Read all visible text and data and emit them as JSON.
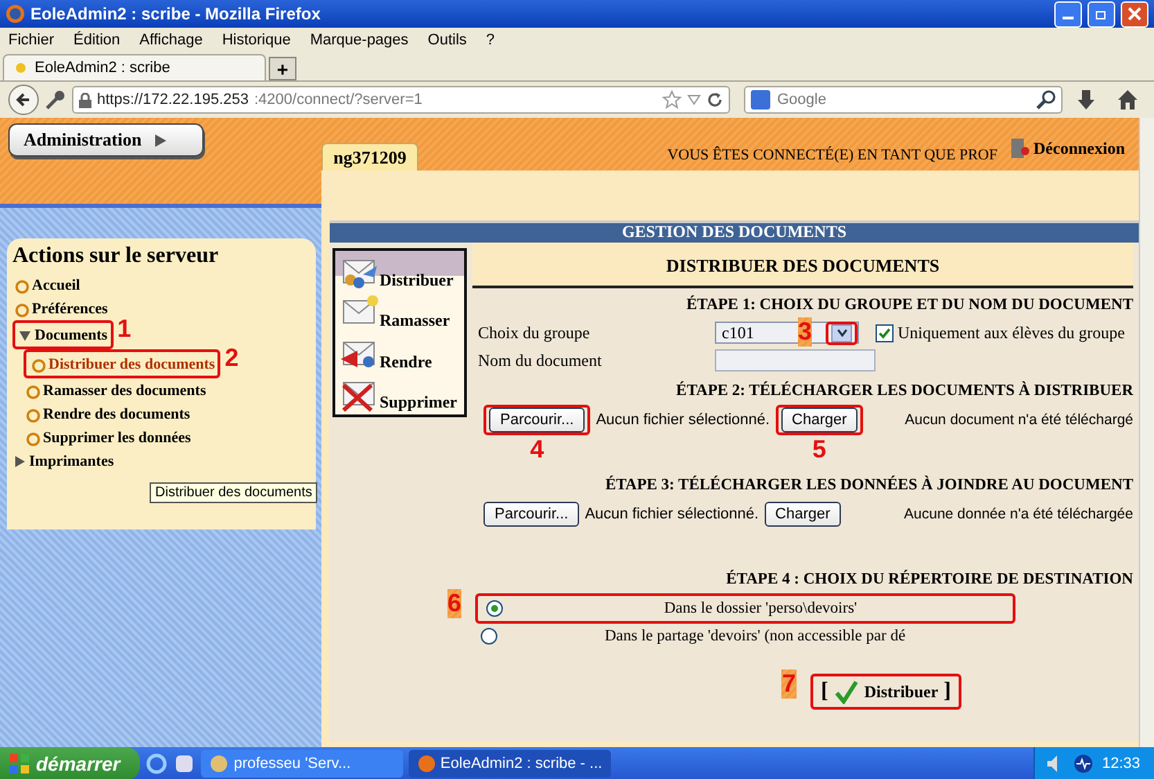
{
  "window": {
    "title": "EoleAdmin2 : scribe - Mozilla Firefox"
  },
  "menu": [
    "Fichier",
    "Édition",
    "Affichage",
    "Historique",
    "Marque-pages",
    "Outils",
    "?"
  ],
  "tabs": [
    {
      "label": "EoleAdmin2 : scribe",
      "selected": true
    }
  ],
  "new_tab": "+",
  "address": {
    "host": "https://172.22.195.253",
    "path": ":4200/connect/?server=1"
  },
  "search": {
    "placeholder": "Google"
  },
  "app": {
    "admin_button": "Administration",
    "user_tab": "ng371209",
    "connected": "VOUS ÊTES CONNECTÉ(E) EN TANT QUE PROF",
    "logout": "Déconnexion"
  },
  "sidebar": {
    "title": "Actions sur le serveur",
    "items": [
      {
        "label": "Accueil",
        "kind": "link"
      },
      {
        "label": "Préférences",
        "kind": "link"
      },
      {
        "label": "Documents",
        "kind": "folder",
        "expanded": true,
        "callout": "1",
        "children": [
          {
            "label": "Distribuer des documents",
            "selected": true,
            "callout": "2"
          },
          {
            "label": "Ramasser des documents",
            "selected": false
          },
          {
            "label": "Rendre des documents",
            "selected": false
          },
          {
            "label": "Supprimer les données",
            "selected": false
          }
        ]
      },
      {
        "label": "Imprimantes",
        "kind": "folder",
        "expanded": false
      }
    ]
  },
  "tooltip": "Distribuer des documents",
  "panel": {
    "title": "GESTION DES DOCUMENTS",
    "heading": "DISTRIBUER DES DOCUMENTS",
    "actions": [
      {
        "label": "Distribuer",
        "kind": "distribute",
        "selected": true
      },
      {
        "label": "Ramasser",
        "kind": "collect",
        "selected": false
      },
      {
        "label": "Rendre",
        "kind": "return",
        "selected": false
      },
      {
        "label": "Supprimer",
        "kind": "delete",
        "selected": false
      }
    ],
    "step1": {
      "title": "ÉTAPE 1: CHOIX DU GROUPE ET DU NOM DU DOCUMENT",
      "group_label": "Choix du groupe",
      "group_value": "c101",
      "callout": "3",
      "only_group": {
        "label": "Uniquement aux élèves du groupe",
        "checked": true
      },
      "name_label": "Nom du document"
    },
    "uploads": [
      {
        "title": "ÉTAPE 2: TÉLÉCHARGER LES DOCUMENTS À DISTRIBUER",
        "browse": "Parcourir...",
        "no_file": "Aucun fichier sélectionné.",
        "load": "Charger",
        "status": "Aucun document n'a été téléchargé",
        "browse_callout": "4",
        "load_callout": "5"
      },
      {
        "title": "ÉTAPE 3: TÉLÉCHARGER LES DONNÉES À JOINDRE AU DOCUMENT",
        "browse": "Parcourir...",
        "no_file": "Aucun fichier sélectionné.",
        "load": "Charger",
        "status": "Aucune donnée n'a été téléchargée"
      }
    ],
    "step4": {
      "title": "ÉTAPE 4 : CHOIX DU RÉPERTOIRE DE DESTINATION",
      "options": [
        {
          "label": "Dans le dossier 'perso\\devoirs'",
          "selected": true,
          "callout": "6"
        },
        {
          "label": "Dans le partage 'devoirs' (non accessible par dé",
          "selected": false
        }
      ]
    },
    "submit": {
      "open": "[",
      "label": "Distribuer",
      "close": "]",
      "callout": "7"
    }
  },
  "taskbar": {
    "start": "démarrer",
    "tasks": [
      {
        "label": "professeu 'Serv...",
        "selected": false
      },
      {
        "label": "EoleAdmin2 : scribe - ...",
        "selected": true
      }
    ],
    "clock": "12:33"
  }
}
